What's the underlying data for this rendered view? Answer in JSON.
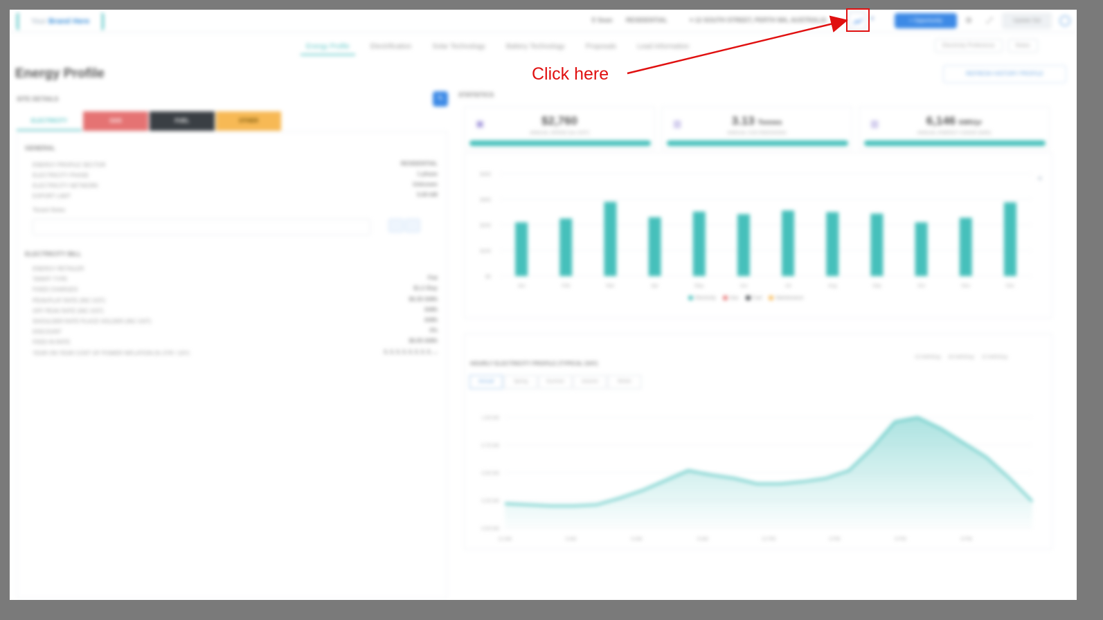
{
  "annotation": {
    "label": "Click here",
    "color": "#e01010"
  },
  "topbar": {
    "brand_prefix": "Your",
    "brand_name": "Brand Here",
    "customer": "Sean",
    "profile_type": "RESIDENTIAL",
    "address": "12 SOUTH STREET, PERTH WA, AUSTRALIA",
    "opportunity_label": "+ Opportunity",
    "update_label": "Update Sal",
    "icons": [
      "user-icon",
      "location-icon",
      "chart-icon",
      "chevron-down-icon",
      "gear-icon",
      "expand-icon",
      "help-icon"
    ]
  },
  "nav": {
    "tabs": [
      "Energy Profile",
      "Electrification",
      "Solar Technology",
      "Battery Technology",
      "Proposals",
      "Lead Information"
    ],
    "right_buttons": [
      "Electricity Preference",
      "Notes"
    ]
  },
  "page": {
    "title": "Energy Profile",
    "refresh_label": "REFRESH HISTORY PROFILE"
  },
  "site_details": {
    "label": "SITE DETAILS",
    "tabs": [
      "ELECTRICITY",
      "GAS",
      "FUEL",
      "OTHER"
    ],
    "general": {
      "label": "GENERAL",
      "rows": [
        {
          "k": "ENERGY PROFILE SECTOR",
          "v": "RESIDENTIAL"
        },
        {
          "k": "ELECTRICITY PHASE",
          "v": "1 phase"
        },
        {
          "k": "ELECTRICITY NETWORK",
          "v": "Unknown"
        },
        {
          "k": "EXPORT LIMIT",
          "v": "5.00 kW"
        }
      ],
      "notes_label": "Tenant Notes"
    },
    "bill": {
      "label": "ELECTRICITY BILL",
      "rows": [
        {
          "k": "ENERGY RETAILER",
          "v": ""
        },
        {
          "k": "TARIFF TYPE",
          "v": "Flat"
        },
        {
          "k": "FIXED CHARGES",
          "v": "$1.2 /Day"
        },
        {
          "k": "PEAK/FLAT RATE (INC GST)",
          "v": "$0.35 /kWh"
        },
        {
          "k": "OFF PEAK RATE (INC GST)",
          "v": "/kWh"
        },
        {
          "k": "SHOULDER RATE PLACE HOLDER (INC GST)",
          "v": "/kWh"
        },
        {
          "k": "DISCOUNT",
          "v": "0%"
        },
        {
          "k": "FEED IN RATE",
          "v": "$0.05 /kWh"
        },
        {
          "k": "YEAR ON YEAR COST OF POWER INFLATION (% 2YR / 10Y)",
          "v": "3, 3, 3, 3, 3, 3, 3, 3, ..."
        }
      ]
    }
  },
  "statistics": {
    "label": "STATISTICS",
    "cards": [
      {
        "value": "$2,760",
        "unit": "",
        "sub": "ANNUAL SPEND (inc GST)",
        "icon": "wallet-icon"
      },
      {
        "value": "3.13",
        "unit": "Tonnes",
        "sub": "ANNUAL CO2 EMISSIONS",
        "icon": "bar-chart-icon"
      },
      {
        "value": "6,146",
        "unit": "kWh/yr",
        "sub": "ANNUAL ENERGY USAGE (kWh)",
        "icon": "bar-chart-icon"
      }
    ],
    "accent": "#46c0bb"
  },
  "chart_data": [
    {
      "type": "bar",
      "categories": [
        "Jan",
        "Feb",
        "Mar",
        "Apr",
        "May",
        "Jun",
        "Jul",
        "Aug",
        "Sep",
        "Oct",
        "Nov",
        "Dec"
      ],
      "series": [
        {
          "name": "Electricity",
          "values": [
            210,
            225,
            290,
            230,
            252,
            242,
            256,
            250,
            244,
            210,
            228,
            288
          ]
        }
      ],
      "y_ticks": [
        "$0",
        "$100",
        "$200",
        "$300",
        "$400"
      ],
      "ylim": [
        0,
        400
      ],
      "legend": [
        "Electricity",
        "Gas",
        "Fuel",
        "Maintenance"
      ],
      "legend_colors": [
        "#46c0bb",
        "#e57373",
        "#3a3f44",
        "#f7b955"
      ]
    },
    {
      "type": "area",
      "title": "HOURLY ELECTRICITY PROFILE (TYPICAL DAY)",
      "tabs": [
        "Annual",
        "Spring",
        "Summer",
        "Autumn",
        "Winter"
      ],
      "x": [
        "12 AM",
        "3 AM",
        "6 AM",
        "9 AM",
        "12 PM",
        "3 PM",
        "6 PM",
        "9 PM"
      ],
      "y_ticks": [
        "0.00 kW",
        "0.25 kW",
        "0.50 kW",
        "0.75 kW",
        "1.00 kW"
      ],
      "ylim": [
        0,
        1
      ],
      "values": [
        0.22,
        0.21,
        0.2,
        0.2,
        0.21,
        0.27,
        0.34,
        0.43,
        0.52,
        0.48,
        0.45,
        0.4,
        0.4,
        0.42,
        0.45,
        0.52,
        0.72,
        0.96,
        1.0,
        0.9,
        0.77,
        0.64,
        0.45,
        0.24
      ],
      "summary": [
        "15 kWh/Day",
        "28 kWh/Day",
        "15 kWh/Day"
      ]
    }
  ]
}
